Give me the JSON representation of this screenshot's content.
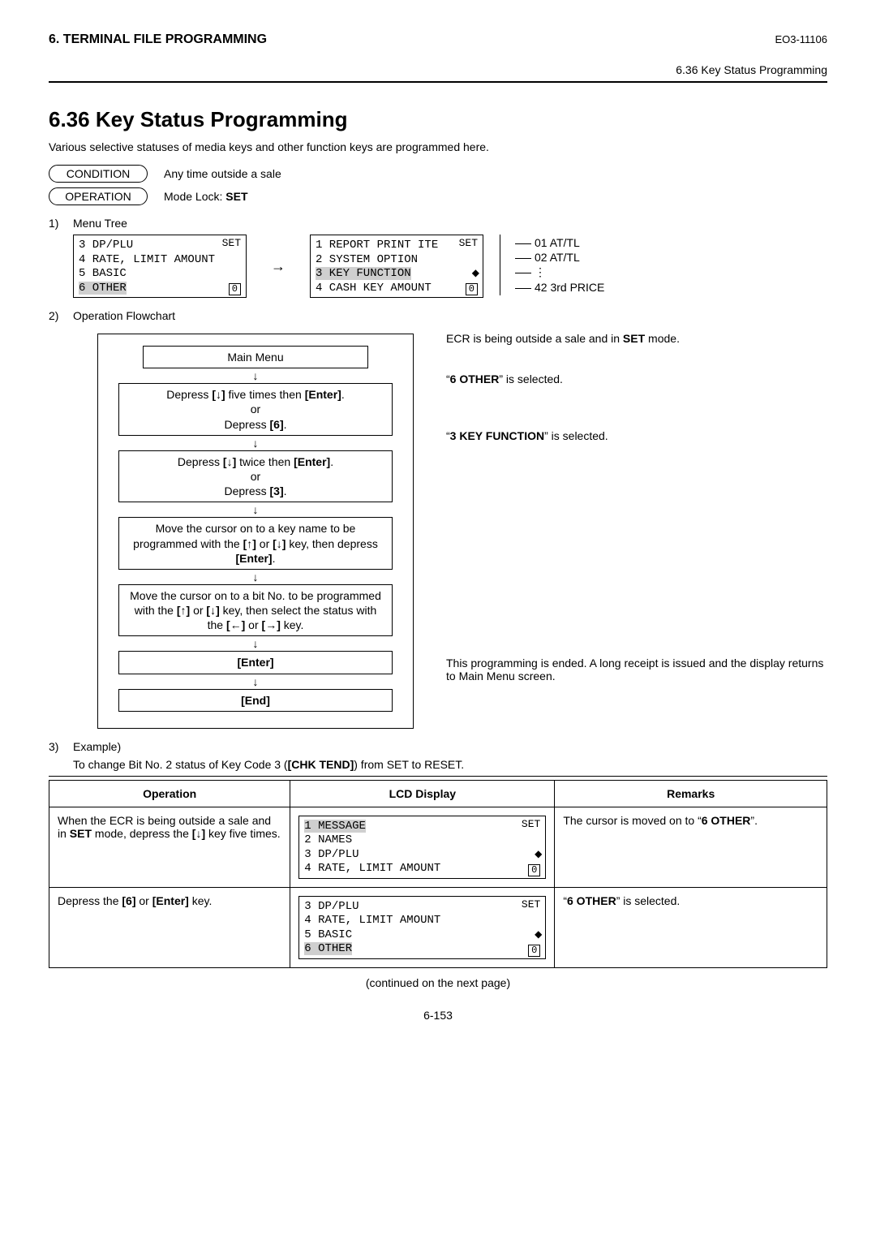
{
  "header": {
    "chapter": "6. TERMINAL FILE PROGRAMMING",
    "doc_id": "EO3-11106",
    "breadcrumb": "6.36 Key Status Programming"
  },
  "title": "6.36   Key Status Programming",
  "intro": "Various selective statuses of media keys and other function keys are programmed here.",
  "condition": {
    "label": "CONDITION",
    "text": "Any time outside a sale"
  },
  "operation": {
    "label": "OPERATION",
    "text_prefix": "Mode Lock: ",
    "text_bold": "SET"
  },
  "sections": {
    "s1": {
      "num": "1)",
      "title": "Menu Tree"
    },
    "s2": {
      "num": "2)",
      "title": "Operation Flowchart"
    },
    "s3": {
      "num": "3)",
      "title": "Example)"
    }
  },
  "menu_tree": {
    "left_box": {
      "mode": "SET",
      "lines": [
        "3 DP/PLU",
        "4 RATE, LIMIT AMOUNT",
        "5 BASIC",
        "6 OTHER"
      ],
      "highlight_index": 3
    },
    "right_box": {
      "mode": "SET",
      "lines": [
        "1 REPORT PRINT ITE",
        "2 SYSTEM OPTION",
        "3 KEY FUNCTION",
        "4 CASH KEY AMOUNT"
      ],
      "highlight_index": 2
    },
    "branches": [
      "01 AT/TL",
      "02 AT/TL",
      "⋮",
      "42 3rd PRICE"
    ]
  },
  "flowchart": {
    "steps": [
      {
        "box": "Main Menu",
        "note_html": "ECR is being outside a sale and in <b>SET</b> mode."
      },
      {
        "box_html": "Depress <b>[↓]</b> five times then <b>[Enter]</b>.<br>or<br>Depress <b>[6]</b>.",
        "note_html": "“<b>6 OTHER</b>” is selected."
      },
      {
        "box_html": "Depress <b>[↓]</b> twice then <b>[Enter]</b>.<br>or<br>Depress <b>[3]</b>.",
        "note_html": "“<b>3 KEY FUNCTION</b>” is selected."
      },
      {
        "box_html": "Move the cursor on to a key name to be programmed with the <b>[↑]</b> or <b>[↓]</b> key, then depress <b>[Enter]</b>."
      },
      {
        "box_html": "Move the cursor on to a bit No. to be programmed with the <b>[↑]</b> or <b>[↓]</b> key, then select the status with the <b>[←]</b> or <b>[→]</b> key."
      },
      {
        "box_html": "<b>[Enter]</b>"
      },
      {
        "box_html": "<b>[End]</b>",
        "note_html": "This programming is ended.  A long receipt is issued and the display returns to Main Menu screen."
      }
    ]
  },
  "example": {
    "intro_html": "To change Bit No. 2 status of Key Code 3 (<b>[CHK TEND]</b>) from SET to RESET.",
    "headers": {
      "op": "Operation",
      "lcd": "LCD Display",
      "rem": "Remarks"
    },
    "rows": [
      {
        "op_html": "When the ECR is being outside a sale and in <b>SET</b> mode, depress the <b>[↓]</b> key five times.",
        "lcd": {
          "mode": "SET",
          "lines": [
            "1 MESSAGE",
            "2 NAMES",
            "3 DP/PLU",
            "4 RATE, LIMIT AMOUNT"
          ],
          "highlight_index": 0
        },
        "rem_html": "The cursor is moved on to “<b>6 OTHER</b>”."
      },
      {
        "op_html": "Depress the <b>[6]</b> or <b>[Enter]</b> key.",
        "lcd": {
          "mode": "SET",
          "lines": [
            "3 DP/PLU",
            "4 RATE, LIMIT AMOUNT",
            "5 BASIC",
            "6 OTHER"
          ],
          "highlight_index": 3
        },
        "rem_html": "“<b>6 OTHER</b>” is selected."
      }
    ]
  },
  "footer": {
    "continued": "(continued on the next page)",
    "page": "6-153"
  }
}
